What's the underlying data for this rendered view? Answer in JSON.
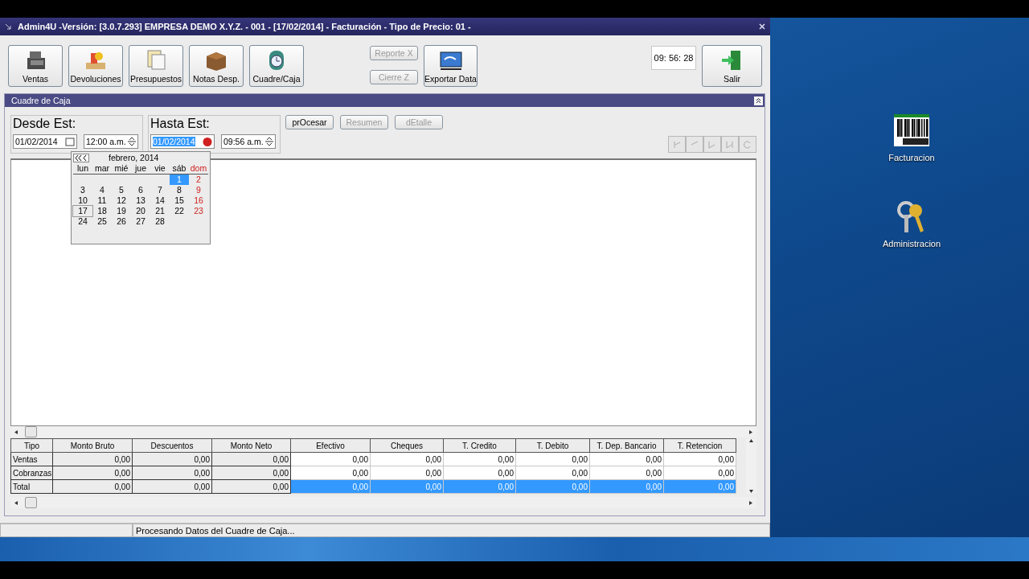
{
  "window": {
    "title": "Admin4U -Versión: [3.0.7.293] EMPRESA DEMO X.Y.Z. - 001 - [17/02/2014]  - Facturación  - Tipo de Precio: 01 -"
  },
  "toolbar": [
    {
      "label": "Ventas",
      "kind": "register"
    },
    {
      "label": "Devoluciones",
      "kind": "returns"
    },
    {
      "label": "Presupuestos",
      "kind": "papers"
    },
    {
      "label": "Notas Desp.",
      "kind": "box"
    },
    {
      "label": "Cuadre/Caja",
      "kind": "clock"
    }
  ],
  "report_buttons": [
    {
      "label": "Reporte X",
      "disabled": true
    },
    {
      "label": "Cierre Z",
      "disabled": true
    }
  ],
  "export_button": {
    "label": "Exportar Data"
  },
  "clock": "09: 56: 28",
  "exit_button": {
    "label": "Salir"
  },
  "panel": {
    "title": "Cuadre de Caja"
  },
  "ranges": [
    {
      "label": "Desde Est:",
      "date": "01/02/2014",
      "time": "12:00 a.m.",
      "date_selected": false
    },
    {
      "label": "Hasta Est:",
      "date": "01/02/2014",
      "time": "09:56 a.m.",
      "date_selected": true
    }
  ],
  "actions": [
    {
      "label": "prOcesar",
      "disabled": false
    },
    {
      "label": "Resumen",
      "disabled": true
    },
    {
      "label": "dEtalle",
      "disabled": true
    }
  ],
  "calendar": {
    "title": "febrero, 2014",
    "weekdays": [
      "lun",
      "mar",
      "mié",
      "jue",
      "vie",
      "sáb",
      "dom"
    ],
    "weeks": [
      {
        "kind": "tail",
        "days": [
          {
            "day": "1",
            "selected": true,
            "today": false
          },
          {
            "day": "2",
            "selected": false,
            "today": false
          }
        ]
      },
      {
        "kind": "head",
        "days": [
          {
            "day": "3",
            "selected": false,
            "today": false
          },
          {
            "day": "4",
            "selected": false,
            "today": false
          },
          {
            "day": "5",
            "selected": false,
            "today": false
          },
          {
            "day": "6",
            "selected": false,
            "today": false
          },
          {
            "day": "7",
            "selected": false,
            "today": false
          },
          {
            "day": "8",
            "selected": false,
            "today": false
          },
          {
            "day": "9",
            "selected": false,
            "today": false
          }
        ]
      },
      {
        "kind": "head",
        "days": [
          {
            "day": "10",
            "selected": false,
            "today": false
          },
          {
            "day": "11",
            "selected": false,
            "today": false
          },
          {
            "day": "12",
            "selected": false,
            "today": false
          },
          {
            "day": "13",
            "selected": false,
            "today": false
          },
          {
            "day": "14",
            "selected": false,
            "today": false
          },
          {
            "day": "15",
            "selected": false,
            "today": false
          },
          {
            "day": "16",
            "selected": false,
            "today": false
          }
        ]
      },
      {
        "kind": "head",
        "days": [
          {
            "day": "17",
            "selected": false,
            "today": true
          },
          {
            "day": "18",
            "selected": false,
            "today": false
          },
          {
            "day": "19",
            "selected": false,
            "today": false
          },
          {
            "day": "20",
            "selected": false,
            "today": false
          },
          {
            "day": "21",
            "selected": false,
            "today": false
          },
          {
            "day": "22",
            "selected": false,
            "today": false
          },
          {
            "day": "23",
            "selected": false,
            "today": false
          }
        ]
      },
      {
        "kind": "head",
        "days": [
          {
            "day": "24",
            "selected": false,
            "today": false
          },
          {
            "day": "25",
            "selected": false,
            "today": false
          },
          {
            "day": "26",
            "selected": false,
            "today": false
          },
          {
            "day": "27",
            "selected": false,
            "today": false
          },
          {
            "day": "28",
            "selected": false,
            "today": false
          }
        ]
      }
    ]
  },
  "table": {
    "columns": [
      "Tipo",
      "Monto Bruto",
      "Descuentos",
      "Monto Neto",
      "Efectivo",
      "Cheques",
      "T. Credito",
      "T. Debito",
      "T. Dep. Bancario",
      "T. Retencion"
    ],
    "rows": [
      {
        "selected": false,
        "cells": [
          "Ventas",
          "0,00",
          "0,00",
          "0,00",
          "0,00",
          "0,00",
          "0,00",
          "0,00",
          "0,00",
          "0,00"
        ]
      },
      {
        "selected": false,
        "cells": [
          "Cobranzas",
          "0,00",
          "0,00",
          "0,00",
          "0,00",
          "0,00",
          "0,00",
          "0,00",
          "0,00",
          "0,00"
        ]
      },
      {
        "selected": true,
        "cells": [
          "Total",
          "0,00",
          "0,00",
          "0,00",
          "0,00",
          "0,00",
          "0,00",
          "0,00",
          "0,00",
          "0,00"
        ]
      }
    ]
  },
  "status_bar": {
    "message": "Procesando Datos del Cuadre de Caja..."
  },
  "desktop_icons": [
    {
      "label": "Facturacion",
      "kind": "barcode"
    },
    {
      "label": "Administracion",
      "kind": "keys"
    }
  ]
}
